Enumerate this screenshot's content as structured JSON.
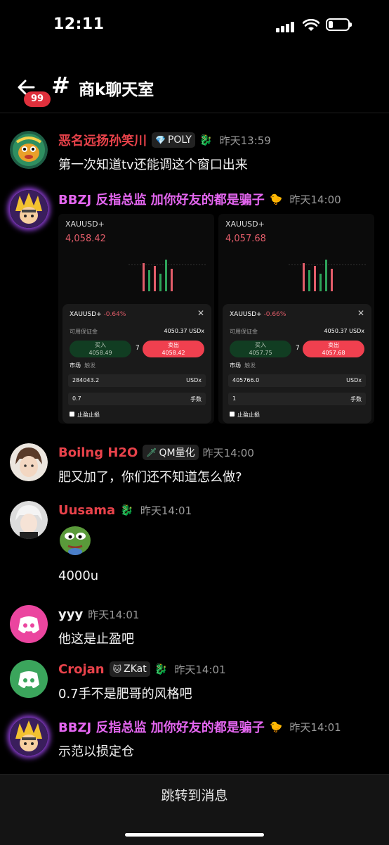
{
  "status_bar": {
    "time": "12:11"
  },
  "header": {
    "unread_badge": "99",
    "hash": "#",
    "title": "商k聊天室"
  },
  "messages": [
    {
      "user": "恶名远扬孙笑川",
      "user_color": "#e8424a",
      "tag": "POLY",
      "time": "昨天13:59",
      "text": "第一次知道tv还能调这个窗口出来"
    },
    {
      "user": "BBZJ 反指总监  加你好友的都是骗子",
      "user_color": "#e466f0",
      "time": "昨天14:00",
      "screenshots": [
        {
          "symbol": "XAUUSD+",
          "price": "4,058.42",
          "change": "-0.64%",
          "available_label": "可用保证金",
          "available": "4050.37 USDx",
          "buy_label": "买入",
          "buy": "4058.49",
          "sell_label": "卖出",
          "sell": "4058.42",
          "spread": "7",
          "tab_market": "市场",
          "tab_trigger": "触发",
          "amount": "284043.2",
          "amount_unit": "USDx",
          "lots": "0.7",
          "lots_unit": "手数",
          "tpsl": "止盈止损"
        },
        {
          "symbol": "XAUUSD+",
          "price": "4,057.68",
          "change": "-0.66%",
          "available_label": "可用保证金",
          "available": "4050.37 USDx",
          "buy_label": "买入",
          "buy": "4057.75",
          "sell_label": "卖出",
          "sell": "4057.68",
          "spread": "7",
          "tab_market": "市场",
          "tab_trigger": "触发",
          "amount": "405766.0",
          "amount_unit": "USDx",
          "lots": "1",
          "lots_unit": "手数",
          "tpsl": "止盈止损"
        }
      ]
    },
    {
      "user": "Boilng H2O",
      "user_color": "#e8424a",
      "tag": "QM量化",
      "time": "昨天14:00",
      "text": "肥又加了，你们还不知道怎么做?"
    },
    {
      "user": "Uusama",
      "user_color": "#e8424a",
      "time": "昨天14:01",
      "text": "4000u"
    },
    {
      "user": "yyy",
      "user_color": "#f0f0f0",
      "time": "昨天14:01",
      "text": "他这是止盈吧"
    },
    {
      "user": "Crojan",
      "user_color": "#e8424a",
      "tag": "ZKat",
      "time": "昨天14:01",
      "text": "0.7手不是肥哥的风格吧"
    },
    {
      "user": "BBZJ 反指总监  加你好友的都是骗子",
      "user_color": "#e466f0",
      "time": "昨天14:01",
      "text": "示范以损定仓"
    }
  ],
  "footer": {
    "jump_label": "跳转到消息"
  },
  "colors": {
    "background": "#000000",
    "accent_red": "#e8424a",
    "accent_pink": "#e466f0",
    "discord_pink": "#eb459f",
    "discord_green": "#3ba55c"
  }
}
